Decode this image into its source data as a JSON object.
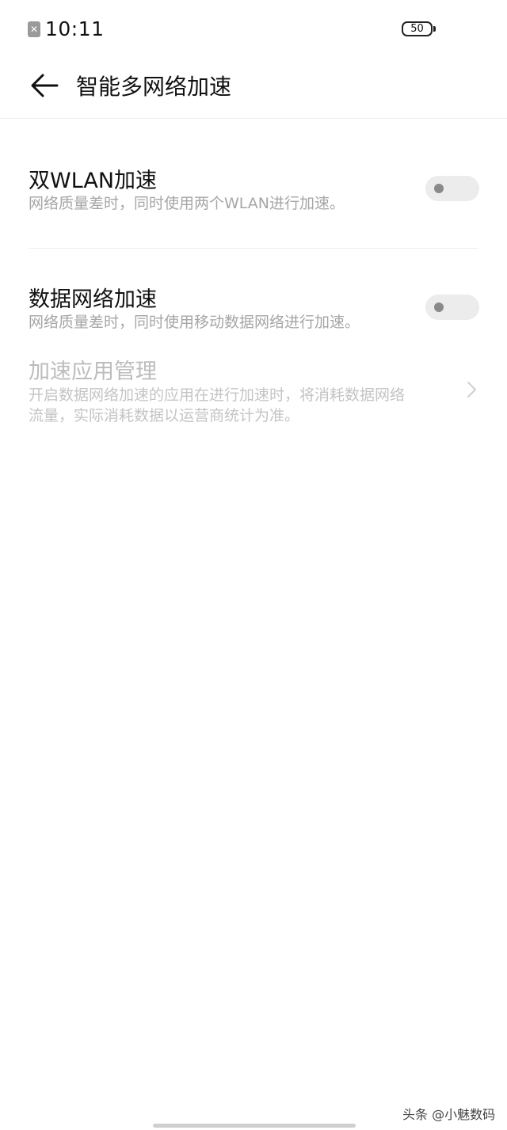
{
  "status_bar": {
    "sim_icon": "sim-off-icon",
    "sim_glyph": "✕",
    "time": "10:11",
    "battery": "50"
  },
  "header": {
    "back_icon": "back-arrow-icon",
    "title": "智能多网络加速"
  },
  "settings": {
    "dual_wlan": {
      "title": "双WLAN加速",
      "description": "网络质量差时，同时使用两个WLAN进行加速。",
      "enabled": false
    },
    "mobile_data": {
      "title": "数据网络加速",
      "description": "网络质量差时，同时使用移动数据网络进行加速。",
      "enabled": false
    },
    "app_management": {
      "title": "加速应用管理",
      "description_line1": "开启数据网络加速的应用在进行加速时，将消耗数据网络",
      "description_line2": "流量，实际消耗数据以运营商统计为准。",
      "icon": "chevron-right-icon"
    }
  },
  "watermark": "头条 @小魅数码",
  "colors": {
    "switch_off_track": "#ececec",
    "switch_off_knob": "#8a8a8a",
    "secondary_text": "#a6a6a6",
    "disabled_text": "#bcbcbc"
  }
}
